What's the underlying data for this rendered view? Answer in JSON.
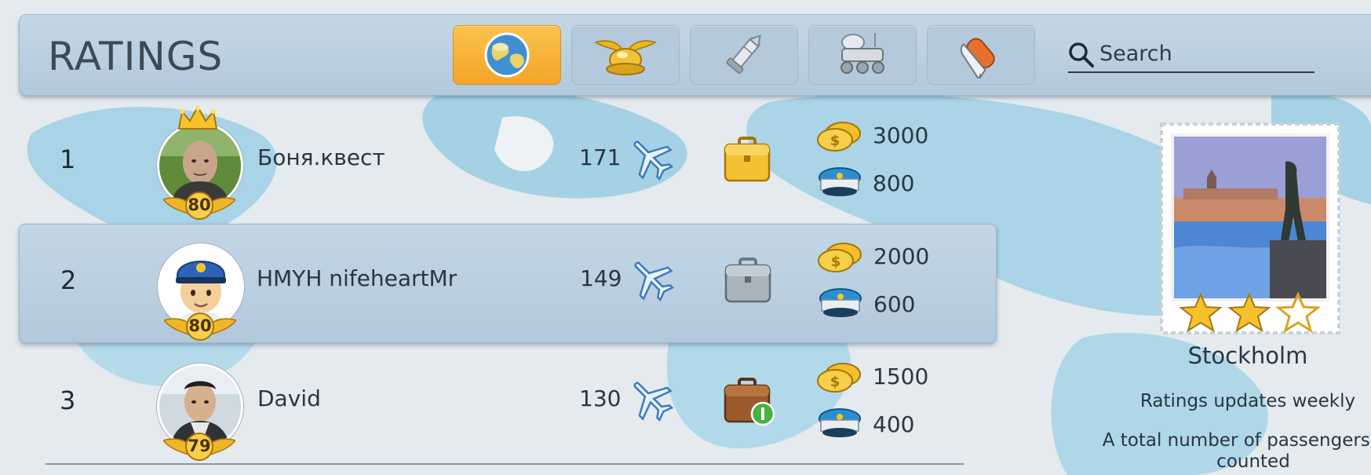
{
  "header": {
    "title": "RATINGS",
    "search_placeholder": "Search",
    "tabs": [
      {
        "icon": "globe-icon",
        "active": true
      },
      {
        "icon": "pilot-wings-icon",
        "active": false
      },
      {
        "icon": "rocket-icon",
        "active": false
      },
      {
        "icon": "lunar-rover-icon",
        "active": false
      },
      {
        "icon": "space-shuttle-icon",
        "active": false
      }
    ]
  },
  "rows": [
    {
      "rank": "1",
      "name": "Боня.квест",
      "level": "80",
      "score": "171",
      "coins": "3000",
      "caps": "800",
      "case": "gold-briefcase-icon",
      "avatar": "photo-man-bald-icon",
      "crown": true,
      "highlight": false
    },
    {
      "rank": "2",
      "name": "HMYH nifeheartMr",
      "level": "80",
      "score": "149",
      "coins": "2000",
      "caps": "600",
      "case": "silver-briefcase-icon",
      "avatar": "pilot-avatar-icon",
      "crown": false,
      "highlight": true
    },
    {
      "rank": "3",
      "name": "David",
      "level": "79",
      "score": "130",
      "coins": "1500",
      "caps": "400",
      "case": "brown-briefcase-icon",
      "avatar": "photo-man-glasses-icon",
      "crown": false,
      "highlight": false
    }
  ],
  "side": {
    "city": "Stockholm",
    "stars_filled": 2,
    "stars_total": 3,
    "info_line1": "Ratings updates weekly",
    "info_line2": "A total number of passengers car counted"
  },
  "colors": {
    "active_tab": "#f7b132",
    "header_bg": "#b8cde0",
    "highlight_row": "#b8cde0"
  }
}
